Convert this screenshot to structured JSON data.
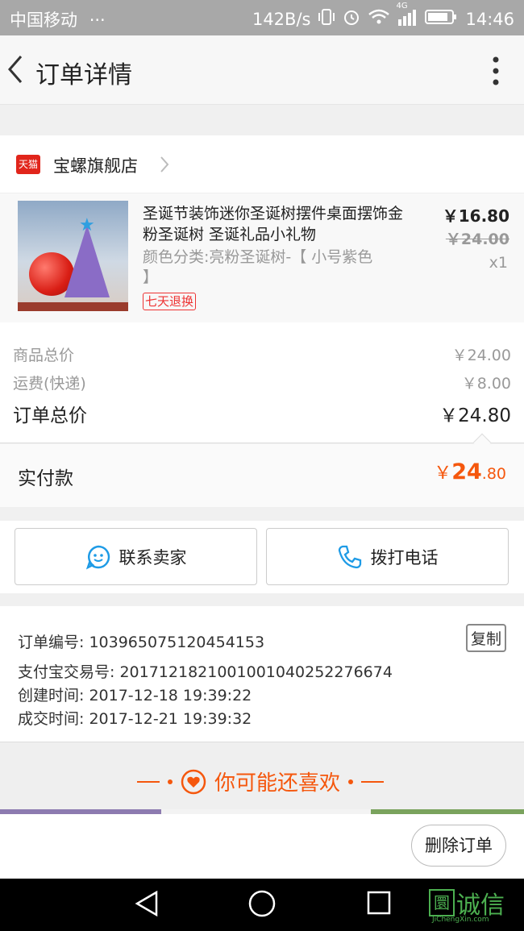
{
  "status_bar": {
    "carrier": "中国移动",
    "dots": "···",
    "speed": "142B/s",
    "network": "4G",
    "time": "14:46"
  },
  "nav": {
    "title": "订单详情"
  },
  "shop": {
    "badge": "天猫",
    "name": "宝螺旗舰店"
  },
  "product": {
    "title": "圣诞节装饰迷你圣诞树摆件桌面摆饰金粉圣诞树 圣诞礼品小礼物",
    "spec": "颜色分类:亮粉圣诞树-【 小号紫色 】",
    "refund_tag": "七天退换",
    "price": "￥16.80",
    "original_price": "￥24.00",
    "quantity": "x1"
  },
  "summary": {
    "goods_total_label": "商品总价",
    "goods_total_value": "￥24.00",
    "shipping_label": "运费(快递)",
    "shipping_value": "￥8.00",
    "order_total_label": "订单总价",
    "order_total_value": "￥24.80"
  },
  "paid": {
    "label": "实付款",
    "currency": "￥",
    "integer": "24",
    "decimal": ".80"
  },
  "actions": {
    "contact_label": "联系卖家",
    "call_label": "拨打电话"
  },
  "info": {
    "order_no_label": "订单编号:",
    "order_no": "103965075120454153",
    "alipay_label": "支付宝交易号:",
    "alipay_no": "2017121821001001040252276674",
    "created_label": "创建时间:",
    "created": "2017-12-18 19:39:22",
    "completed_label": "成交时间:",
    "completed": "2017-12-21 19:39:32",
    "copy_label": "复制"
  },
  "recommend": {
    "title": "你可能还喜欢"
  },
  "bottom": {
    "delete_label": "删除订单"
  },
  "watermark": {
    "glyph": "圜",
    "text": "诚信",
    "sub": "JiChengXin.com"
  },
  "colors": {
    "accent": "#f5570d",
    "tmall_red": "#e1251b",
    "link_blue": "#1e9be6"
  }
}
